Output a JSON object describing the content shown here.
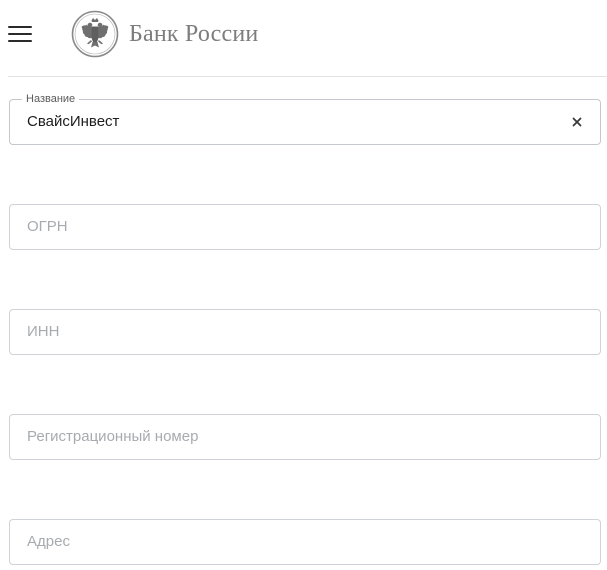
{
  "header": {
    "menu_icon": "hamburger-menu-icon",
    "logo_icon": "double-headed-eagle-emblem-icon",
    "logo_text": "Банк России"
  },
  "form": {
    "fields": [
      {
        "label": "Название",
        "value": "СвайсИнвест",
        "clear_icon": "close-icon"
      },
      {
        "placeholder": "ОГРН",
        "value": ""
      },
      {
        "placeholder": "ИНН",
        "value": ""
      },
      {
        "placeholder": "Регистрационный номер",
        "value": ""
      },
      {
        "placeholder": "Адрес",
        "value": ""
      }
    ]
  },
  "colors": {
    "logo_gray": "#7d7d7d",
    "border": "#cfd2d6",
    "placeholder": "#a7abb0",
    "text": "#1d1d1d"
  }
}
